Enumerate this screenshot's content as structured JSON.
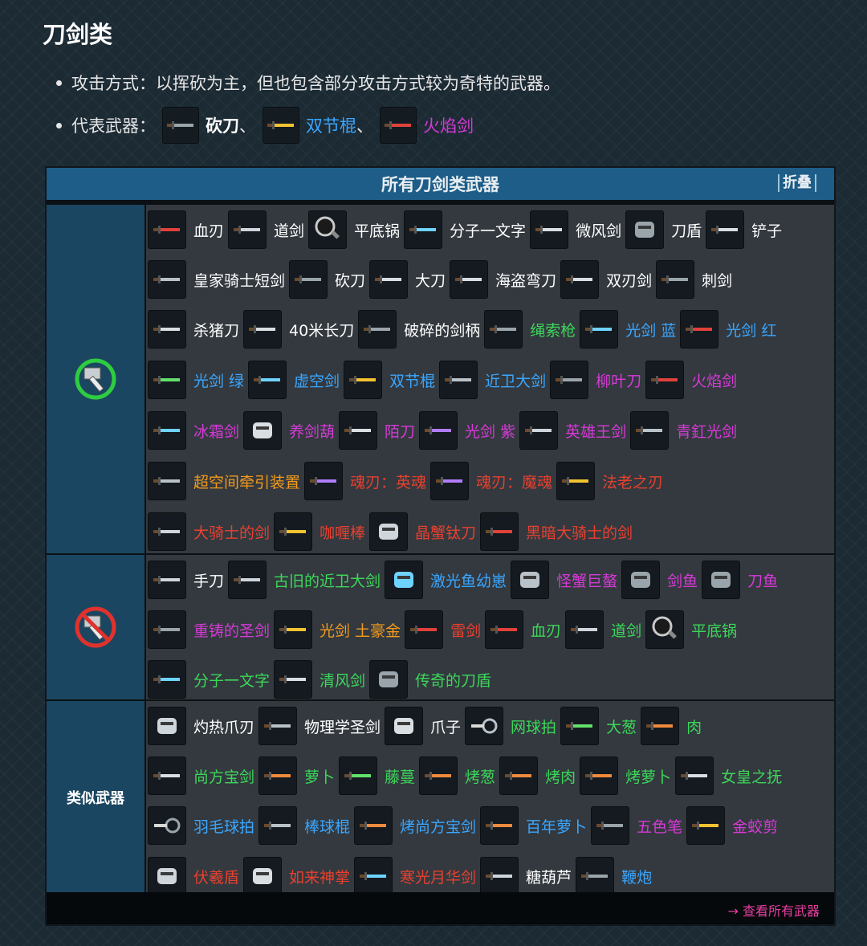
{
  "page": {
    "title": "刀剑类",
    "attack_label": "攻击方式：以挥砍为主，但也包含部分攻击方式较为奇特的武器。",
    "rep_label": "代表武器：",
    "rep_weapons": [
      {
        "name": "砍刀",
        "color": "#ffffff",
        "bold": true,
        "icon": "machete-icon"
      },
      {
        "name": "双节棍",
        "color": "#3aa6ff",
        "icon": "nunchaku-icon"
      },
      {
        "name": "火焰剑",
        "color": "#d63ad6",
        "icon": "flame-sword-icon"
      }
    ],
    "rep_sep": "、"
  },
  "table": {
    "title": "所有刀剑类武器",
    "fold": "折叠",
    "footer_link": "→ 查看所有武器",
    "sections": [
      {
        "label": "",
        "icon": "hammer-green-icon",
        "rows": [
          [
            {
              "name": "血刃",
              "color": "#ffffff",
              "icon": "blood-blade-icon"
            },
            {
              "name": "道剑",
              "color": "#ffffff",
              "icon": "tao-sword-icon"
            },
            {
              "name": "平底锅",
              "color": "#ffffff",
              "icon": "frying-pan-icon"
            },
            {
              "name": "分子一文字",
              "color": "#ffffff",
              "icon": "molecular-blade-icon"
            },
            {
              "name": "微风剑",
              "color": "#ffffff",
              "icon": "breeze-sword-icon"
            },
            {
              "name": "刀盾",
              "color": "#ffffff",
              "icon": "sword-shield-icon"
            },
            {
              "name": "铲子",
              "color": "#ffffff",
              "icon": "shovel-icon"
            }
          ],
          [
            {
              "name": "皇家骑士短剑",
              "color": "#ffffff",
              "icon": "royal-knight-dagger-icon"
            },
            {
              "name": "砍刀",
              "color": "#ffffff",
              "icon": "machete-icon"
            },
            {
              "name": "大刀",
              "color": "#ffffff",
              "icon": "broadsword-icon"
            },
            {
              "name": "海盗弯刀",
              "color": "#ffffff",
              "icon": "pirate-cutlass-icon"
            },
            {
              "name": "双刃剑",
              "color": "#ffffff",
              "icon": "double-edged-sword-icon"
            },
            {
              "name": "刺剑",
              "color": "#ffffff",
              "icon": "rapier-icon"
            }
          ],
          [
            {
              "name": "杀猪刀",
              "color": "#ffffff",
              "icon": "butcher-knife-icon"
            },
            {
              "name": "40米长刀",
              "color": "#ffffff",
              "icon": "long-blade-icon"
            },
            {
              "name": "破碎的剑柄",
              "color": "#ffffff",
              "icon": "broken-hilt-icon"
            },
            {
              "name": "绳索枪",
              "color": "#3dd65a",
              "icon": "rope-gun-icon"
            },
            {
              "name": "光剑 蓝",
              "color": "#3aa6ff",
              "icon": "lightsaber-blue-icon"
            },
            {
              "name": "光剑 红",
              "color": "#3aa6ff",
              "icon": "lightsaber-red-icon"
            }
          ],
          [
            {
              "name": "光剑 绿",
              "color": "#3aa6ff",
              "icon": "lightsaber-green-icon"
            },
            {
              "name": "虚空剑",
              "color": "#3aa6ff",
              "icon": "void-sword-icon"
            },
            {
              "name": "双节棍",
              "color": "#3aa6ff",
              "icon": "nunchaku-icon"
            },
            {
              "name": "近卫大剑",
              "color": "#3aa6ff",
              "icon": "guard-greatsword-icon"
            },
            {
              "name": "柳叶刀",
              "color": "#d63ad6",
              "icon": "lancet-icon"
            },
            {
              "name": "火焰剑",
              "color": "#d63ad6",
              "icon": "flame-sword-icon"
            }
          ],
          [
            {
              "name": "冰霜剑",
              "color": "#d63ad6",
              "icon": "frost-sword-icon"
            },
            {
              "name": "养剑葫",
              "color": "#d63ad6",
              "icon": "sword-gourd-icon"
            },
            {
              "name": "陌刀",
              "color": "#d63ad6",
              "icon": "mo-dao-icon"
            },
            {
              "name": "光剑 紫",
              "color": "#d63ad6",
              "icon": "lightsaber-purple-icon"
            },
            {
              "name": "英雄王剑",
              "color": "#d63ad6",
              "icon": "hero-king-sword-icon"
            },
            {
              "name": "青釭光剑",
              "color": "#d63ad6",
              "icon": "qinggang-lightsword-icon"
            }
          ],
          [
            {
              "name": "超空间牵引装置",
              "color": "#f39a1c",
              "icon": "hyperspace-tractor-icon"
            },
            {
              "name": "魂刃：英魂",
              "color": "#e8402f",
              "icon": "soul-blade-hero-icon"
            },
            {
              "name": "魂刃：魔魂",
              "color": "#e8402f",
              "icon": "soul-blade-demon-icon"
            },
            {
              "name": "法老之刃",
              "color": "#e8402f",
              "icon": "pharaoh-blade-icon"
            }
          ],
          [
            {
              "name": "大骑士的剑",
              "color": "#e8402f",
              "icon": "grand-knight-sword-icon"
            },
            {
              "name": "咖喱棒",
              "color": "#e8402f",
              "icon": "curry-stick-icon"
            },
            {
              "name": "晶蟹钛刀",
              "color": "#e8402f",
              "icon": "crystal-crab-blade-icon"
            },
            {
              "name": "黑暗大骑士的剑",
              "color": "#e8402f",
              "icon": "dark-knight-sword-icon"
            }
          ]
        ]
      },
      {
        "label": "",
        "icon": "hammer-banned-icon",
        "rows": [
          [
            {
              "name": "手刀",
              "color": "#ffffff",
              "icon": "hand-blade-icon"
            },
            {
              "name": "古旧的近卫大剑",
              "color": "#3dd65a",
              "icon": "old-guard-greatsword-icon"
            },
            {
              "name": "激光鱼幼崽",
              "color": "#3aa6ff",
              "icon": "laser-fish-cub-icon"
            },
            {
              "name": "怪蟹巨螯",
              "color": "#d63ad6",
              "icon": "crab-claw-icon"
            },
            {
              "name": "剑鱼",
              "color": "#d63ad6",
              "icon": "swordfish-icon"
            },
            {
              "name": "刀鱼",
              "color": "#d63ad6",
              "icon": "knifefish-icon"
            }
          ],
          [
            {
              "name": "重铸的圣剑",
              "color": "#d63ad6",
              "icon": "reforged-holy-sword-icon"
            },
            {
              "name": "光剑 土豪金",
              "color": "#f39a1c",
              "icon": "lightsaber-gold-icon"
            },
            {
              "name": "雷剑",
              "color": "#e8402f",
              "icon": "thunder-sword-icon"
            },
            {
              "name": "血刃",
              "color": "#3dd65a",
              "icon": "blood-blade-icon"
            },
            {
              "name": "道剑",
              "color": "#3dd65a",
              "icon": "tao-sword-icon"
            },
            {
              "name": "平底锅",
              "color": "#3dd65a",
              "icon": "frying-pan-icon"
            }
          ],
          [
            {
              "name": "分子一文字",
              "color": "#3dd65a",
              "icon": "molecular-blade-icon"
            },
            {
              "name": "清风剑",
              "color": "#3dd65a",
              "icon": "breeze-sword-icon"
            },
            {
              "name": "传奇的刀盾",
              "color": "#3dd65a",
              "icon": "legend-sword-shield-icon"
            }
          ]
        ]
      },
      {
        "label": "类似武器",
        "icon": "",
        "rows": [
          [
            {
              "name": "灼热爪刃",
              "color": "#ffffff",
              "icon": "scorching-claw-icon"
            },
            {
              "name": "物理学圣剑",
              "color": "#ffffff",
              "icon": "crowbar-icon"
            },
            {
              "name": "爪子",
              "color": "#ffffff",
              "icon": "claw-icon"
            },
            {
              "name": "网球拍",
              "color": "#3dd65a",
              "icon": "tennis-racket-icon"
            },
            {
              "name": "大葱",
              "color": "#3dd65a",
              "icon": "scallion-icon"
            },
            {
              "name": "肉",
              "color": "#3dd65a",
              "icon": "meat-icon"
            }
          ],
          [
            {
              "name": "尚方宝剑",
              "color": "#3dd65a",
              "icon": "imperial-sword-icon"
            },
            {
              "name": "萝卜",
              "color": "#3dd65a",
              "icon": "carrot-icon"
            },
            {
              "name": "藤蔓",
              "color": "#3dd65a",
              "icon": "vine-icon"
            },
            {
              "name": "烤葱",
              "color": "#3dd65a",
              "icon": "roasted-scallion-icon"
            },
            {
              "name": "烤肉",
              "color": "#3dd65a",
              "icon": "roasted-meat-icon"
            },
            {
              "name": "烤萝卜",
              "color": "#3dd65a",
              "icon": "roasted-carrot-icon"
            },
            {
              "name": "女皇之抚",
              "color": "#3dd65a",
              "icon": "empress-caress-icon"
            }
          ],
          [
            {
              "name": "羽毛球拍",
              "color": "#3aa6ff",
              "icon": "badminton-racket-icon"
            },
            {
              "name": "棒球棍",
              "color": "#3aa6ff",
              "icon": "baseball-bat-icon"
            },
            {
              "name": "烤尚方宝剑",
              "color": "#3aa6ff",
              "icon": "roasted-imperial-sword-icon"
            },
            {
              "name": "百年萝卜",
              "color": "#3aa6ff",
              "icon": "century-carrot-icon"
            },
            {
              "name": "五色笔",
              "color": "#d63ad6",
              "icon": "five-color-brush-icon"
            },
            {
              "name": "金蛟剪",
              "color": "#d63ad6",
              "icon": "golden-scissors-icon"
            }
          ],
          [
            {
              "name": "伏羲盾",
              "color": "#e8402f",
              "icon": "fuxi-shield-icon"
            },
            {
              "name": "如来神掌",
              "color": "#e8402f",
              "icon": "buddha-palm-icon"
            },
            {
              "name": "寒光月华剑",
              "color": "#e8402f",
              "icon": "moonlight-sword-icon"
            },
            {
              "name": "糖葫芦",
              "color": "#ffffff",
              "icon": "candied-haws-icon"
            },
            {
              "name": "鞭炮",
              "color": "#3aa6ff",
              "icon": "firecracker-icon"
            }
          ]
        ]
      }
    ]
  }
}
